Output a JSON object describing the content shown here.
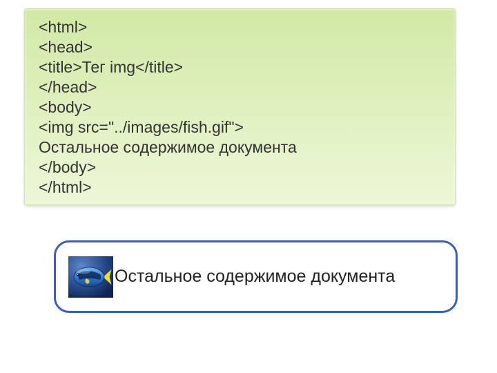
{
  "code": {
    "lines": [
      "<html>",
      "<head>",
      "<title>Тег img</title>",
      "</head>",
      "<body>",
      "<img src=\"../images/fish.gif\">",
      "Остальное содержимое документа",
      "</body>",
      "</html>"
    ]
  },
  "result": {
    "image_name": "fish",
    "text": "Остальное содержимое документа"
  }
}
